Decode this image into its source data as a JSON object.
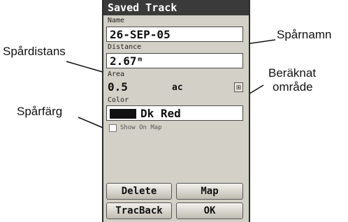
{
  "screen": {
    "title": "Saved Track",
    "name": {
      "label": "Name",
      "value": "26-SEP-05"
    },
    "distance": {
      "label": "Distance",
      "value": "2.67ᵐ"
    },
    "area": {
      "label": "Area",
      "value": "0.5",
      "unit": "ac"
    },
    "color": {
      "label": "Color",
      "value": "Dk Red",
      "swatch": "#111111"
    },
    "show_on_map": {
      "label": "Show On Map",
      "checked": false
    },
    "buttons": {
      "delete": "Delete",
      "map": "Map",
      "trackback": "TracBack",
      "ok": "OK"
    }
  },
  "callouts": {
    "sparnamn": "Spårnamn",
    "spardistans": "Spårdistans",
    "berakat_line1": "Beräknat",
    "berakat_line2": "område",
    "sparfarg": "Spårfärg"
  },
  "colors": {
    "screen_bg": "#d3d1c7",
    "titlebar_bg": "#3a3a3a"
  }
}
